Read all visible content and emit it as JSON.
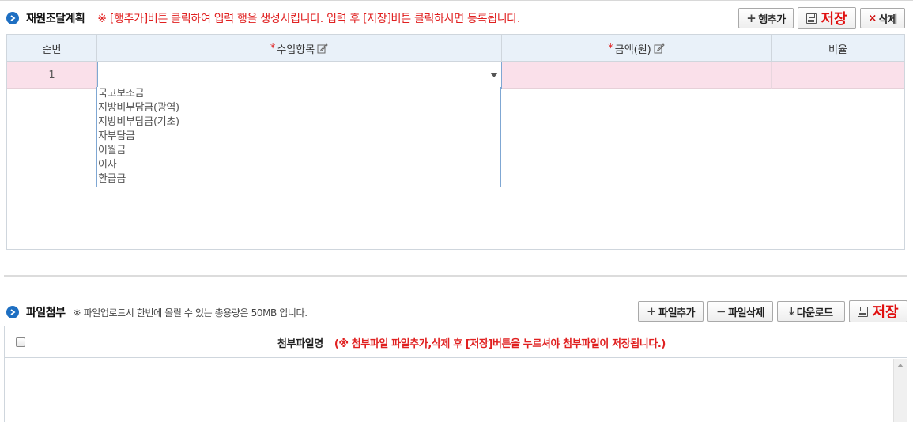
{
  "funding": {
    "title": "재원조달계획",
    "notice": "※ [행추가]버튼 클릭하여 입력 행을 생성시킵니다. 입력 후 [저장]버튼 클릭하시면 등록됩니다.",
    "buttons": {
      "add_row": "행추가",
      "save": "저장",
      "delete": "삭제"
    },
    "columns": {
      "seq": "순번",
      "income_item": "수입항목",
      "amount": "금액(원)",
      "ratio": "비율",
      "required_mark": "*"
    },
    "rows": [
      {
        "seq": "1",
        "income_item": "",
        "amount": "",
        "ratio": ""
      }
    ],
    "dropdown_options": [
      "국고보조금",
      "지방비부담금(광역)",
      "지방비부담금(기초)",
      "자부담금",
      "이월금",
      "이자",
      "환급금"
    ]
  },
  "attachments": {
    "title": "파일첨부",
    "notice": "※ 파일업로드시 한번에 올릴 수 있는 총용량은 50MB 입니다.",
    "buttons": {
      "add_file": "파일추가",
      "delete_file": "파일삭제",
      "download": "다운로드",
      "save": "저장"
    },
    "columns": {
      "filename": "첨부파일명",
      "filename_note": "(※ 첨부파일 파일추가,삭제 후 [저장]버튼을 누르셔야 첨부파일이 저장됩니다.)"
    }
  },
  "colors": {
    "accent": "#1e6fc2",
    "notice": "#e02020",
    "header_bg": "#e9f1f9",
    "row_selected": "#fae0ea"
  }
}
